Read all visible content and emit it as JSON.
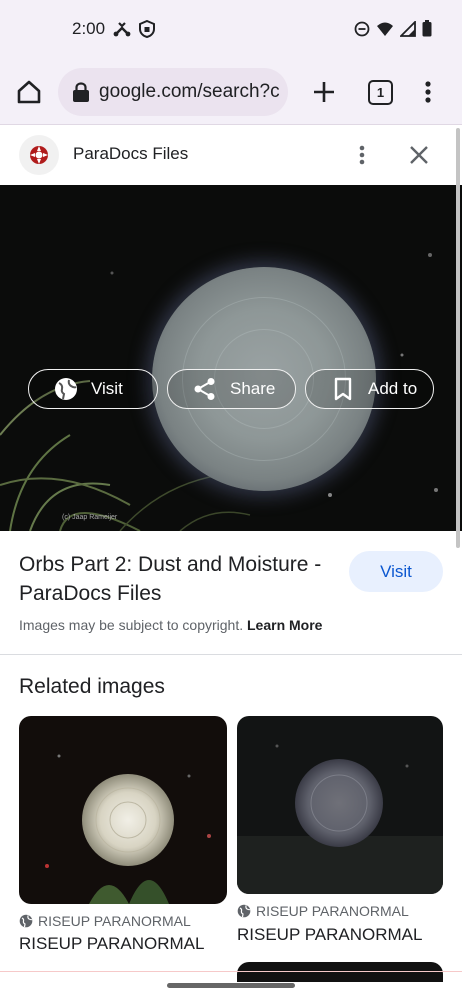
{
  "status_bar": {
    "time": "2:00",
    "left_icons": [
      "network-icon",
      "shield-icon"
    ],
    "right_icons": [
      "do-not-disturb-icon",
      "wifi-icon",
      "cell-signal-icon",
      "battery-icon"
    ]
  },
  "toolbar": {
    "url": "google.com/search?c",
    "tab_count": "1",
    "icons": [
      "home-icon",
      "lock-icon",
      "plus-icon",
      "tab-switcher-icon",
      "more-vert-icon"
    ]
  },
  "source": {
    "name": "ParaDocs Files"
  },
  "hero": {
    "credit": "(c) Jaap Rameijer",
    "actions": [
      {
        "label": "Visit",
        "icon": "globe-icon"
      },
      {
        "label": "Share",
        "icon": "share-icon"
      },
      {
        "label": "Add to",
        "icon": "bookmark-icon"
      }
    ]
  },
  "result": {
    "title": "Orbs Part 2: Dust and Moisture - ParaDocs Files",
    "visit_label": "Visit",
    "copyright_text": "Images may be subject to copyright.",
    "learn_more": "Learn More"
  },
  "related": {
    "heading": "Related images",
    "items": [
      {
        "source": "RISEUP PARANORMAL",
        "title": "RISEUP PARANORMAL"
      },
      {
        "source": "RISEUP PARANORMAL",
        "title": "RISEUP PARANORMAL"
      }
    ]
  },
  "colors": {
    "accent_blue": "#0b57d0",
    "visit_button_bg": "#e8f0fe",
    "toolbar_bg": "#f4f0f8"
  }
}
